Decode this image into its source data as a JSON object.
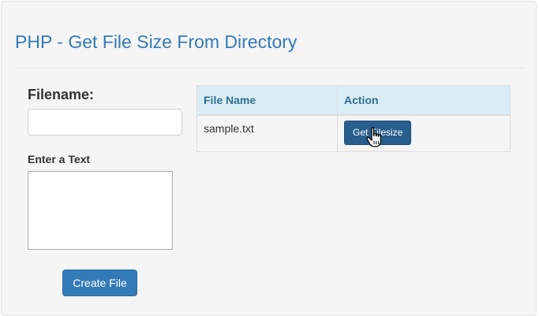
{
  "page": {
    "title": "PHP - Get File Size From Directory"
  },
  "form": {
    "filename_label": "Filename:",
    "filename_value": "",
    "text_label": "Enter a Text",
    "text_value": "",
    "create_button": "Create File"
  },
  "table": {
    "headers": [
      "File Name",
      "Action"
    ],
    "rows": [
      {
        "file_name": "sample.txt",
        "action_label": "Get Filesize"
      }
    ]
  },
  "colors": {
    "accent": "#337ab7",
    "header_bg": "#d9edf7",
    "header_text": "#31708f",
    "panel_bg": "#f5f5f5"
  },
  "icons": {
    "cursor": "hand-pointer-icon"
  }
}
